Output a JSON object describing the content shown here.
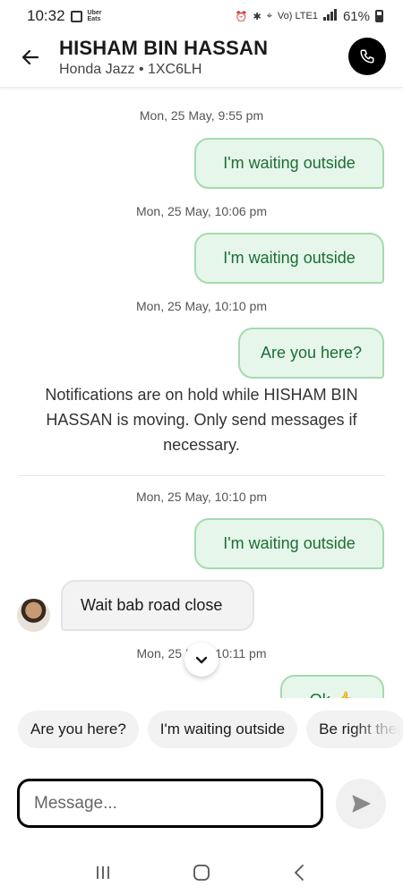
{
  "status_bar": {
    "time": "10:32",
    "app_notification": "Uber Eats",
    "network": "Vo) LTE1",
    "battery": "61%"
  },
  "header": {
    "driver_name": "HISHAM BIN HASSAN",
    "vehicle": "Honda Jazz • 1XC6LH"
  },
  "messages": [
    {
      "type": "timestamp",
      "text": "Mon, 25 May, 9:55 pm"
    },
    {
      "type": "outgoing",
      "text": "I'm waiting outside"
    },
    {
      "type": "timestamp",
      "text": "Mon, 25 May, 10:06 pm"
    },
    {
      "type": "outgoing",
      "text": "I'm waiting outside"
    },
    {
      "type": "timestamp",
      "text": "Mon, 25 May, 10:10 pm"
    },
    {
      "type": "outgoing",
      "text": "Are you here?"
    },
    {
      "type": "notice",
      "text": "Notifications are on hold while HISHAM BIN HASSAN is moving. Only send messages if necessary."
    },
    {
      "type": "timestamp",
      "text": "Mon, 25 May, 10:10 pm"
    },
    {
      "type": "outgoing",
      "text": "I'm waiting outside"
    },
    {
      "type": "incoming",
      "text": "Wait bab road close"
    },
    {
      "type": "timestamp",
      "text": "Mon, 25 May, 10:11 pm"
    },
    {
      "type": "outgoing",
      "text": "Ok 👍"
    }
  ],
  "quick_replies": [
    "Are you here?",
    "I'm waiting outside",
    "Be right there"
  ],
  "composer": {
    "placeholder": "Message..."
  },
  "colors": {
    "outgoing_bubble_bg": "#e7f6ea",
    "outgoing_bubble_border": "#a4dbae",
    "outgoing_text": "#1b6e36",
    "call_button": "#000000"
  },
  "icons": {
    "back": "arrow-left-icon",
    "call": "phone-icon",
    "scroll_down": "chevron-down-icon",
    "send": "send-icon",
    "nav_recents": "recents-icon",
    "nav_home": "home-icon",
    "nav_back": "nav-back-icon"
  }
}
